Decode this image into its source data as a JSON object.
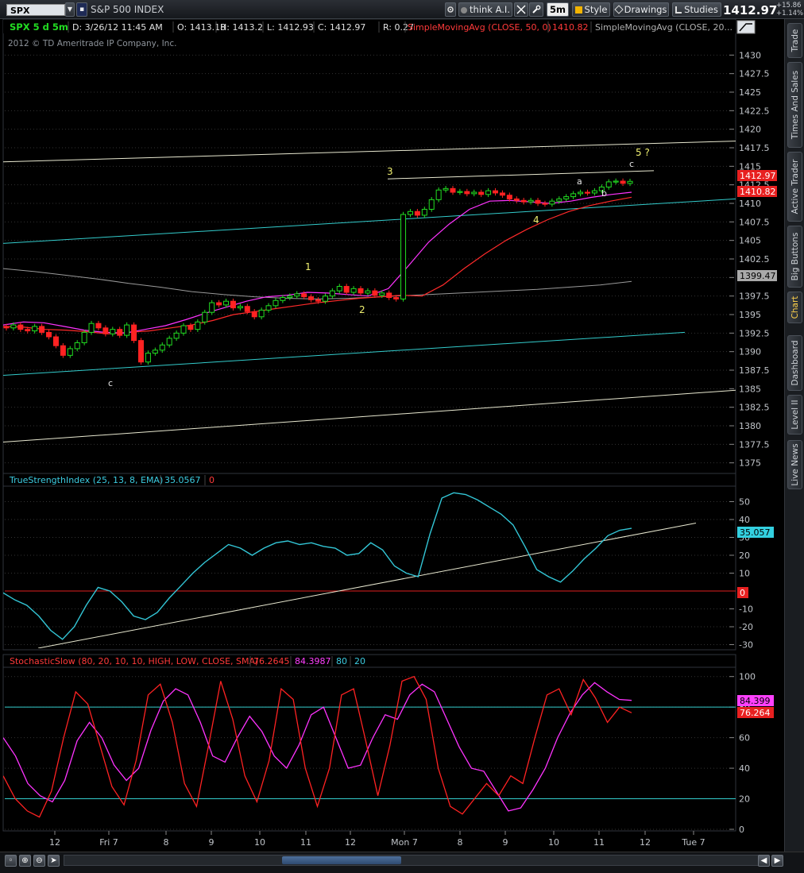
{
  "toolbar": {
    "symbol": "SPX",
    "instrument": "S&P 500 INDEX",
    "link_glyph": "▪",
    "dropdown_glyph": "▼",
    "think_ai": "think A.I.",
    "timeframe": "5m",
    "style": "Style",
    "drawings": "Drawings",
    "studies": "Studies",
    "last_price": "1412.97",
    "change_abs": "+15.86",
    "change_pct": "+1.14%"
  },
  "side_tabs": [
    "Trade",
    "Times And Sales",
    "Active Trader",
    "Big Buttons",
    "Chart",
    "Dashboard",
    "Level II",
    "Live News"
  ],
  "active_tab": "Chart",
  "price_panel": {
    "title": "SPX 5 d 5m",
    "date": "D: 3/26/12 11:45 AM",
    "open": "O: 1413.18",
    "high": "H: 1413.2",
    "low": "L: 1412.93",
    "close": "C: 1412.97",
    "range": "R: 0.27",
    "sma50_label": "SimpleMovingAvg (CLOSE, 50, 0)",
    "sma50_value": "1410.82",
    "sma200_label": "SimpleMovingAvg (CLOSE, 20...",
    "copyright": "2012 © TD Ameritrade IP Company, Inc.",
    "price_badge": "1412.97",
    "sma50_badge": "1410.82",
    "sma200_badge": "1399.47",
    "wave_labels": [
      "1",
      "2",
      "3",
      "4",
      "5 ?",
      "a",
      "b",
      "c",
      "c"
    ]
  },
  "tsi_panel": {
    "label": "TrueStrengthIndex (25, 13, 8, EMA)",
    "value": "35.0567",
    "zero": "0",
    "value_badge": "35.057",
    "zero_badge": "0"
  },
  "stoch_panel": {
    "label": "StochasticSlow (80, 20, 10, 10, HIGH, LOW, CLOSE, SMA)",
    "k_value": "76.2645",
    "d_value": "84.3987",
    "over_bought": "80",
    "over_sold": "20",
    "d_badge": "84.399",
    "k_badge": "76.264"
  },
  "x_axis_labels": [
    "12",
    "Fri  7",
    "8",
    "9",
    "10",
    "11",
    "12",
    "Mon  7",
    "8",
    "9",
    "10",
    "11",
    "12",
    "Tue  7"
  ],
  "bottom_bar": {
    "buttons": [
      "◦",
      "⊕",
      "⊖",
      "➤"
    ],
    "left_arrow": "◀",
    "right_arrow": "▶"
  },
  "colors": {
    "candle_up": "#22dd22",
    "candle_down": "#ff2222",
    "sma50": "#ff2a2a",
    "sma20": "#ff33ff",
    "sma200": "#9a9a9a",
    "channel_cyan": "#33cccc",
    "trend_white": "#e8e8d0",
    "tsi": "#33c6d6",
    "stoch_k": "#ff2222",
    "stoch_d": "#ff33ff",
    "wave_label": "#f0f070"
  },
  "chart_data": [
    {
      "type": "candlestick",
      "name": "SPX 5 d 5m",
      "ylim": [
        1372.5,
        1432.5
      ],
      "y_ticks": [
        1375,
        1377.5,
        1380,
        1382.5,
        1385,
        1387.5,
        1390,
        1392.5,
        1395,
        1397.5,
        1400,
        1402.5,
        1405,
        1407.5,
        1410,
        1412.5,
        1415,
        1417.5,
        1420,
        1422.5,
        1425,
        1427.5,
        1430
      ],
      "close_path": [
        1393.2,
        1393.6,
        1393.0,
        1392.8,
        1393.4,
        1392.6,
        1392.0,
        1390.8,
        1389.5,
        1390.4,
        1391.2,
        1392.6,
        1393.8,
        1393.2,
        1392.4,
        1393.0,
        1392.2,
        1393.6,
        1391.5,
        1388.6,
        1389.8,
        1390.2,
        1390.9,
        1391.8,
        1392.5,
        1393.5,
        1393.0,
        1394.0,
        1395.3,
        1396.6,
        1396.3,
        1396.8,
        1395.9,
        1396.1,
        1395.4,
        1394.7,
        1395.6,
        1396.2,
        1396.9,
        1397.3,
        1397.5,
        1397.8,
        1397.4,
        1397.0,
        1396.8,
        1397.5,
        1398.2,
        1398.8,
        1398.0,
        1398.5,
        1397.9,
        1398.2,
        1397.6,
        1397.9,
        1397.3,
        1397.1,
        1408.5,
        1408.9,
        1408.4,
        1409.2,
        1410.5,
        1411.8,
        1412.0,
        1411.5,
        1411.6,
        1411.3,
        1411.5,
        1411.2,
        1411.7,
        1411.4,
        1411.1,
        1410.6,
        1410.4,
        1410.2,
        1410.4,
        1410.0,
        1409.9,
        1410.3,
        1410.6,
        1410.9,
        1411.3,
        1411.5,
        1411.4,
        1411.7,
        1412.2,
        1412.9,
        1413.0,
        1412.7,
        1412.97
      ],
      "sma50_path": [
        1393.4,
        1393.3,
        1393.0,
        1392.9,
        1392.7,
        1392.4,
        1392.6,
        1392.8,
        1393.2,
        1393.6,
        1394.2,
        1395.0,
        1395.4,
        1395.8,
        1396.2,
        1396.6,
        1396.9,
        1397.2,
        1397.4,
        1397.6,
        1397.5,
        1399.0,
        1401.2,
        1403.2,
        1405.0,
        1406.5,
        1407.8,
        1408.9,
        1409.7,
        1410.3,
        1410.82
      ],
      "sma20_path": [
        1393.6,
        1394.0,
        1393.9,
        1393.4,
        1392.9,
        1392.6,
        1392.5,
        1393.0,
        1393.5,
        1394.3,
        1395.2,
        1396.0,
        1396.8,
        1397.4,
        1397.6,
        1398.0,
        1397.9,
        1397.7,
        1397.5,
        1398.5,
        1401.6,
        1404.8,
        1407.2,
        1409.2,
        1410.3,
        1410.4,
        1410.2,
        1410.0,
        1410.3,
        1410.8,
        1411.2,
        1411.5
      ],
      "sma200_path": [
        1401.2,
        1400.8,
        1400.3,
        1399.8,
        1399.2,
        1398.7,
        1398.1,
        1397.7,
        1397.4,
        1397.2,
        1397.1,
        1397.2,
        1397.4,
        1397.6,
        1397.8,
        1398.0,
        1398.2,
        1398.4,
        1398.7,
        1399.0,
        1399.47
      ],
      "channel_lines": [
        {
          "color": "cyan",
          "from": 1404.6,
          "to": 1410.6
        },
        {
          "color": "cyan",
          "from": 1386.8,
          "to": 1392.6
        },
        {
          "color": "white",
          "from": 1377.8,
          "to": 1384.8
        },
        {
          "color": "white",
          "from": 1415.6,
          "to": 1418.4
        },
        {
          "color": "white",
          "from": 1413.3,
          "to": 1414.4
        }
      ]
    },
    {
      "type": "line",
      "name": "TrueStrengthIndex (25, 13, 8, EMA)",
      "ylim": [
        -32,
        56
      ],
      "y_ticks": [
        -30,
        -20,
        -10,
        0,
        10,
        20,
        30,
        40,
        50
      ],
      "values": [
        -1,
        -5,
        -8,
        -14,
        -22,
        -27,
        -20,
        -8,
        2,
        0,
        -6,
        -14,
        -16,
        -12,
        -4,
        3,
        10,
        16,
        21,
        26,
        24,
        20,
        24,
        27,
        28,
        26,
        27,
        25,
        24,
        20,
        21,
        27,
        23,
        14,
        10,
        8,
        32,
        52,
        55,
        54,
        51,
        47,
        43,
        37,
        25,
        12,
        8,
        5,
        11,
        18,
        24,
        31,
        34,
        35.06
      ],
      "trendline": {
        "from": -32,
        "to": 38
      }
    },
    {
      "type": "line",
      "name": "StochasticSlow (80, 20, 10, 10, HIGH, LOW, CLOSE, SMA)",
      "ylim": [
        0,
        104
      ],
      "y_ticks": [
        0,
        20,
        40,
        60,
        80,
        100
      ],
      "levels": [
        80,
        20
      ],
      "k_values": [
        35,
        20,
        12,
        8,
        25,
        60,
        90,
        82,
        55,
        28,
        16,
        45,
        88,
        95,
        70,
        30,
        15,
        55,
        97,
        72,
        35,
        18,
        45,
        92,
        85,
        40,
        15,
        40,
        88,
        92,
        58,
        22,
        55,
        97,
        100,
        85,
        40,
        15,
        10,
        20,
        30,
        22,
        35,
        30,
        60,
        88,
        92,
        75,
        98,
        86,
        70,
        80,
        76.26
      ],
      "d_values": [
        60,
        48,
        30,
        22,
        18,
        32,
        58,
        70,
        60,
        42,
        32,
        40,
        65,
        84,
        92,
        88,
        70,
        48,
        44,
        60,
        74,
        64,
        48,
        40,
        55,
        75,
        80,
        60,
        40,
        42,
        60,
        75,
        72,
        88,
        95,
        90,
        72,
        54,
        40,
        38,
        25,
        12,
        14,
        26,
        40,
        60,
        76,
        88,
        96,
        90,
        85,
        84.4
      ]
    }
  ]
}
